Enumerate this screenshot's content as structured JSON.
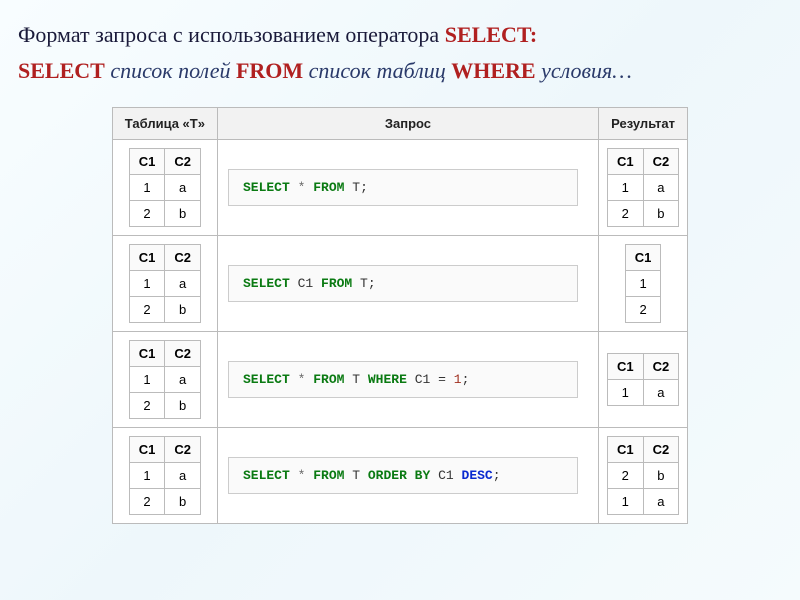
{
  "heading": {
    "prefix": "Формат запроса с использованием оператора ",
    "kw": "SELECT:"
  },
  "syntax": {
    "select_kw": "SELECT",
    "fields": " список полей ",
    "from_kw": "FROM",
    "tables": " список таблиц ",
    "where_kw": "WHERE",
    "conds": " условия…"
  },
  "table": {
    "headers": {
      "t": "Таблица «T»",
      "q": "Запрос",
      "r": "Результат"
    },
    "source": {
      "cols": [
        "C1",
        "C2"
      ],
      "rows": [
        [
          "1",
          "a"
        ],
        [
          "2",
          "b"
        ]
      ]
    },
    "rows": [
      {
        "query": {
          "tokens": [
            {
              "t": "SELECT",
              "c": "sql-kw"
            },
            {
              "t": " "
            },
            {
              "t": "*",
              "c": "sql-star"
            },
            {
              "t": " "
            },
            {
              "t": "FROM",
              "c": "sql-kw"
            },
            {
              "t": " "
            },
            {
              "t": "T",
              "c": "sql-id"
            },
            {
              "t": ";",
              "c": "sql-semi"
            }
          ]
        },
        "result": {
          "cols": [
            "C1",
            "C2"
          ],
          "rows": [
            [
              "1",
              "a"
            ],
            [
              "2",
              "b"
            ]
          ]
        }
      },
      {
        "query": {
          "tokens": [
            {
              "t": "SELECT",
              "c": "sql-kw"
            },
            {
              "t": " "
            },
            {
              "t": "C1",
              "c": "sql-id"
            },
            {
              "t": " "
            },
            {
              "t": "FROM",
              "c": "sql-kw"
            },
            {
              "t": " "
            },
            {
              "t": "T",
              "c": "sql-id"
            },
            {
              "t": ";",
              "c": "sql-semi"
            }
          ]
        },
        "result": {
          "cols": [
            "C1"
          ],
          "rows": [
            [
              "1"
            ],
            [
              "2"
            ]
          ]
        }
      },
      {
        "query": {
          "tokens": [
            {
              "t": "SELECT",
              "c": "sql-kw"
            },
            {
              "t": " "
            },
            {
              "t": "*",
              "c": "sql-star"
            },
            {
              "t": " "
            },
            {
              "t": "FROM",
              "c": "sql-kw"
            },
            {
              "t": " "
            },
            {
              "t": "T",
              "c": "sql-id"
            },
            {
              "t": " "
            },
            {
              "t": "WHERE",
              "c": "sql-kw"
            },
            {
              "t": " "
            },
            {
              "t": "C1",
              "c": "sql-id"
            },
            {
              "t": " "
            },
            {
              "t": "=",
              "c": "sql-id"
            },
            {
              "t": " "
            },
            {
              "t": "1",
              "c": "sql-num"
            },
            {
              "t": ";",
              "c": "sql-semi"
            }
          ]
        },
        "result": {
          "cols": [
            "C1",
            "C2"
          ],
          "rows": [
            [
              "1",
              "a"
            ]
          ]
        }
      },
      {
        "query": {
          "tokens": [
            {
              "t": "SELECT",
              "c": "sql-kw"
            },
            {
              "t": " "
            },
            {
              "t": "*",
              "c": "sql-star"
            },
            {
              "t": " "
            },
            {
              "t": "FROM",
              "c": "sql-kw"
            },
            {
              "t": " "
            },
            {
              "t": "T",
              "c": "sql-id"
            },
            {
              "t": " "
            },
            {
              "t": "ORDER BY",
              "c": "sql-kw"
            },
            {
              "t": " "
            },
            {
              "t": "C1",
              "c": "sql-id"
            },
            {
              "t": " "
            },
            {
              "t": "DESC",
              "c": "sql-dir"
            },
            {
              "t": ";",
              "c": "sql-semi"
            }
          ]
        },
        "result": {
          "cols": [
            "C1",
            "C2"
          ],
          "rows": [
            [
              "2",
              "b"
            ],
            [
              "1",
              "a"
            ]
          ]
        }
      }
    ]
  }
}
